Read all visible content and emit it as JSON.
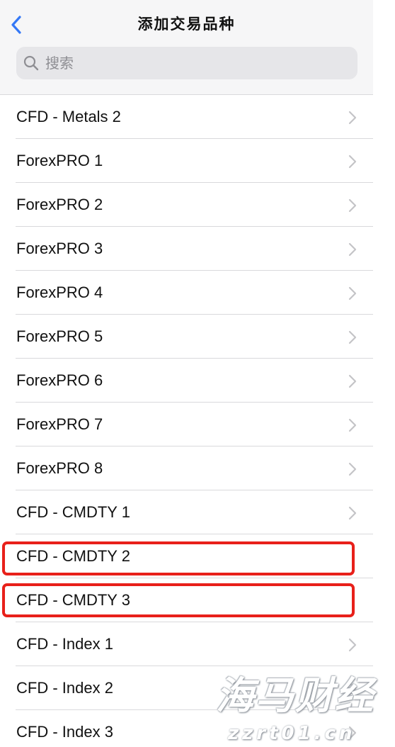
{
  "header": {
    "title": "添加交易品种",
    "back_icon": "chevron-left-icon"
  },
  "search": {
    "placeholder": "搜索",
    "icon": "search-icon"
  },
  "colors": {
    "accent": "#3478f6",
    "highlight": "#e8201a",
    "header_bg": "#f6f6f7",
    "search_bg": "#e6e6e9",
    "divider": "#d9d9dc",
    "chevron": "#c4c4c7"
  },
  "list": {
    "items": [
      {
        "label": "CFD - Metals 2",
        "chevron": true,
        "highlighted": false
      },
      {
        "label": "ForexPRO 1",
        "chevron": true,
        "highlighted": false
      },
      {
        "label": "ForexPRO 2",
        "chevron": true,
        "highlighted": false
      },
      {
        "label": "ForexPRO 3",
        "chevron": true,
        "highlighted": false
      },
      {
        "label": "ForexPRO 4",
        "chevron": true,
        "highlighted": false
      },
      {
        "label": "ForexPRO 5",
        "chevron": true,
        "highlighted": false
      },
      {
        "label": "ForexPRO 6",
        "chevron": true,
        "highlighted": false
      },
      {
        "label": "ForexPRO 7",
        "chevron": true,
        "highlighted": false
      },
      {
        "label": "ForexPRO 8",
        "chevron": true,
        "highlighted": false
      },
      {
        "label": "CFD - CMDTY 1",
        "chevron": true,
        "highlighted": false
      },
      {
        "label": "CFD - CMDTY 2",
        "chevron": false,
        "highlighted": true
      },
      {
        "label": "CFD - CMDTY 3",
        "chevron": false,
        "highlighted": true
      },
      {
        "label": "CFD - Index 1",
        "chevron": true,
        "highlighted": false
      },
      {
        "label": "CFD - Index 2",
        "chevron": true,
        "highlighted": false
      },
      {
        "label": "CFD - Index 3",
        "chevron": true,
        "highlighted": false
      }
    ]
  },
  "watermark": {
    "brand": "海马财经",
    "url": "zzrt01.cn"
  }
}
